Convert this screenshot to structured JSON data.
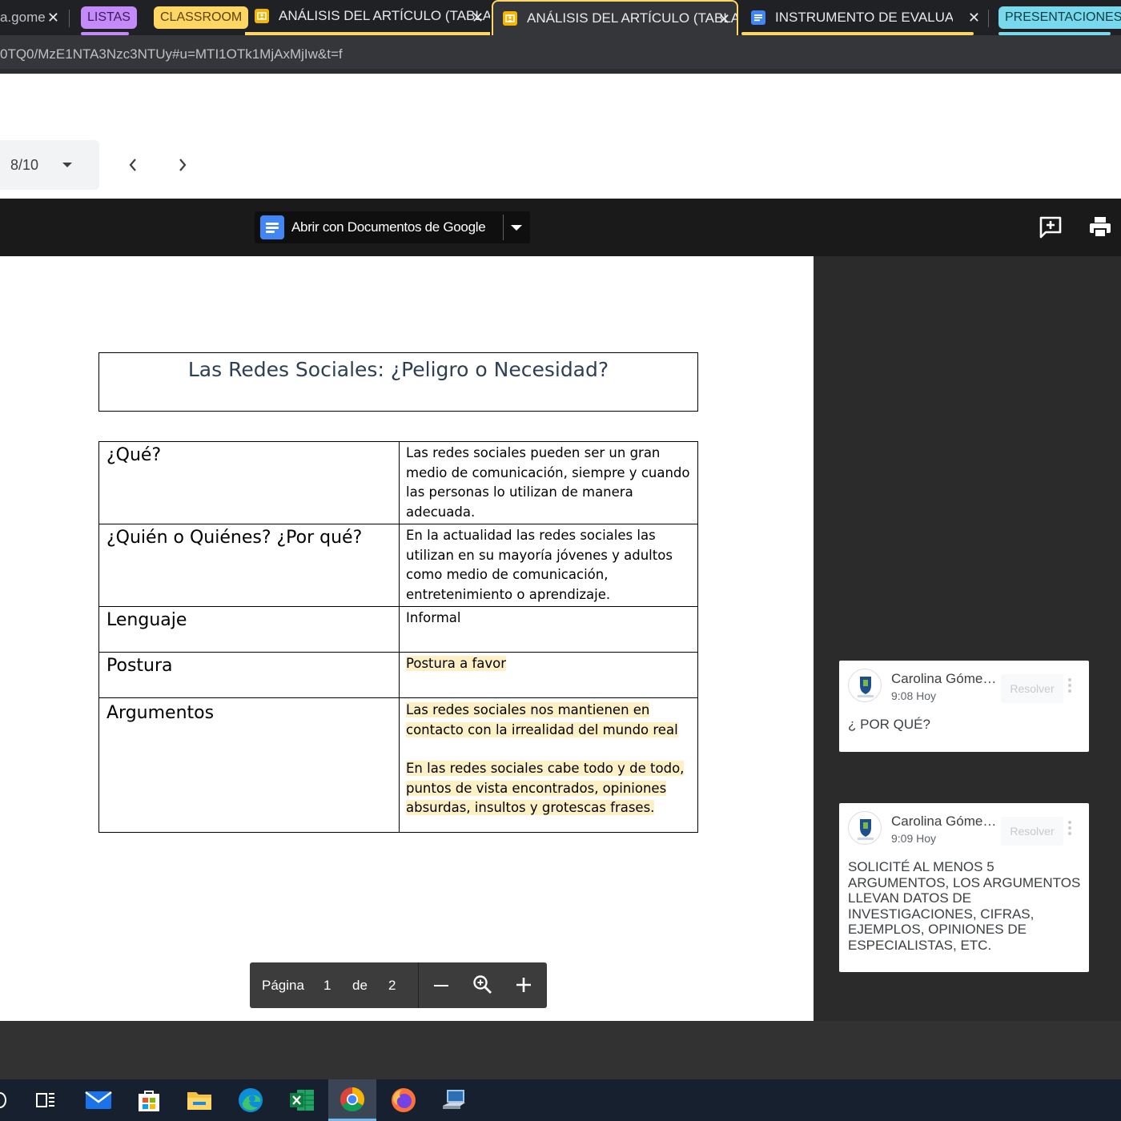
{
  "tabs": [
    {
      "label": "a.gome",
      "close": "✕"
    },
    {
      "group": "LISTAS",
      "group_color": "#c58af9"
    },
    {
      "group": "CLASSROOM",
      "group_color": "#fdd663"
    },
    {
      "label": "ANÁLISIS DEL ARTÍCULO (TABLA)",
      "icon": "slides-icon",
      "close": "✕"
    },
    {
      "label": "ANÁLISIS DEL ARTÍCULO (TABLA)",
      "icon": "slides-icon",
      "close": "✕",
      "active": true
    },
    {
      "label": "INSTRUMENTO DE EVALUACIÓN",
      "icon": "docs-icon",
      "close": "✕"
    },
    {
      "group": "PRESENTACIONES",
      "group_color": "#78d9ec"
    }
  ],
  "address": {
    "url": "0TQ0/MzE1NTA3Nzc3NTUy#u=MTI1OTk1MjAxMjIw&t=f"
  },
  "slides_nav": {
    "counter": "8/10",
    "prev": "‹",
    "next": "›"
  },
  "viewer": {
    "open_with_label": "Abrir con Documentos de Google"
  },
  "document": {
    "title": "Las Redes Sociales: ¿Peligro o Necesidad?",
    "rows": [
      {
        "label": "¿Qué?",
        "value": "Las redes sociales pueden ser un gran medio de comunicación, siempre y cuando las personas lo utilizan de manera adecuada."
      },
      {
        "label": "¿Quién o Quiénes? ¿Por qué?",
        "value": "En la actualidad las redes sociales las utilizan en su mayoría jóvenes y adultos como medio de comunicación, entretenimiento o aprendizaje."
      },
      {
        "label": "Lenguaje",
        "value": "Informal"
      },
      {
        "label": "Postura",
        "value": "Postura a favor"
      },
      {
        "label": "Argumentos",
        "value": "Las redes sociales nos mantienen en contacto con la irrealidad del mundo real",
        "value2": "En las redes sociales cabe todo y de todo, puntos de vista encontrados, opiniones absurdas, insultos y grotescas frases."
      }
    ]
  },
  "page_controls": {
    "page_label": "Página",
    "current": "1",
    "of": "de",
    "total": "2"
  },
  "comments": [
    {
      "author": "Carolina Góme…",
      "time": "9:08 Hoy",
      "resolve": "Resolver",
      "text": "¿ POR QUÉ?"
    },
    {
      "author": "Carolina Góme…",
      "time": "9:09 Hoy",
      "resolve": "Resolver",
      "text": "SOLICITÉ AL MENOS 5 ARGUMENTOS, LOS ARGUMENTOS LLEVAN DATOS DE INVESTIGACIONES, CIFRAS, EJEMPLOS, OPINIONES DE ESPECIALISTAS, ETC."
    }
  ],
  "colors": {
    "highlight": "#fdf0c5",
    "active_tab_group": "#fdd663",
    "docs_blue": "#4285f4",
    "slides_yellow": "#f4b400"
  },
  "taskbar": [
    "task-view-icon",
    "mail-icon",
    "store-icon",
    "file-explorer-icon",
    "edge-icon",
    "excel-icon",
    "chrome-icon",
    "firefox-icon",
    "remote-desktop-icon"
  ]
}
